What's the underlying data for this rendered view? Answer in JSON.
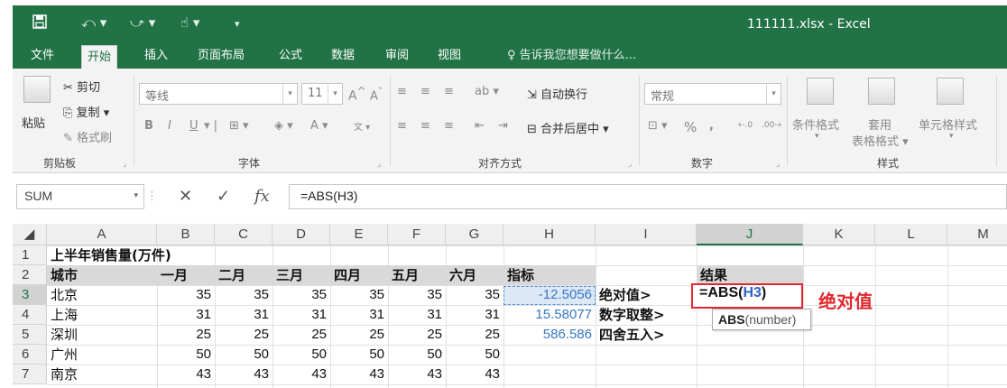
{
  "window": {
    "title": "111111.xlsx  -  Excel"
  },
  "quick_access": {
    "icons": [
      "save-icon",
      "undo-icon",
      "redo-icon",
      "touch-mode-icon",
      "customize-icon"
    ]
  },
  "tabs": [
    {
      "label": "文件"
    },
    {
      "label": "开始"
    },
    {
      "label": "插入"
    },
    {
      "label": "页面布局"
    },
    {
      "label": "公式"
    },
    {
      "label": "数据"
    },
    {
      "label": "审阅"
    },
    {
      "label": "视图"
    }
  ],
  "tell_me": "告诉我您想要做什么...",
  "ribbon": {
    "clipboard": {
      "paste": "粘贴",
      "cut": "剪切",
      "copy": "复制",
      "format_painter": "格式刷",
      "group": "剪贴板"
    },
    "font": {
      "font_name": "等线",
      "font_size": "11",
      "bold": "B",
      "italic": "I",
      "underline": "U",
      "grow": "A",
      "shrink": "A",
      "group": "字体"
    },
    "alignment": {
      "wrap": "自动换行",
      "merge": "合并后居中",
      "group": "对齐方式"
    },
    "number": {
      "format": "常规",
      "percent": "%",
      "comma": ",",
      "group": "数字"
    },
    "styles": {
      "conditional": "条件格式",
      "table_line1": "套用",
      "table_line2": "表格格式",
      "cell_styles": "单元格样式",
      "group": "样式"
    }
  },
  "formula_bar": {
    "name_box": "SUM",
    "cancel": "✕",
    "enter": "✓",
    "fx": "fx",
    "formula": "=ABS(H3)"
  },
  "columns": [
    "A",
    "B",
    "C",
    "D",
    "E",
    "F",
    "G",
    "H",
    "I",
    "J",
    "K",
    "L",
    "M"
  ],
  "rows": [
    "1",
    "2",
    "3",
    "4",
    "5",
    "6",
    "7"
  ],
  "sheet": {
    "title": "上半年销售量(万件)",
    "headers": [
      "城市",
      "一月",
      "二月",
      "三月",
      "四月",
      "五月",
      "六月"
    ],
    "data": [
      {
        "city": "北京",
        "values": [
          "35",
          "35",
          "35",
          "35",
          "35",
          "35"
        ]
      },
      {
        "city": "上海",
        "values": [
          "31",
          "31",
          "31",
          "31",
          "31",
          "31"
        ]
      },
      {
        "city": "深圳",
        "values": [
          "25",
          "25",
          "25",
          "25",
          "25",
          "25"
        ]
      },
      {
        "city": "广州",
        "values": [
          "50",
          "50",
          "50",
          "50",
          "50",
          "50"
        ]
      },
      {
        "city": "南京",
        "values": [
          "43",
          "43",
          "43",
          "43",
          "43",
          "43"
        ]
      }
    ],
    "indicator_header": "指标",
    "indicators": [
      "-12.5056",
      "15.58077",
      "586.586"
    ],
    "labels": [
      "绝对值>",
      "数字取整>",
      "四舍五入>"
    ],
    "result_header": "结果",
    "editing": {
      "prefix": "=ABS(",
      "ref": "H3",
      "suffix": ")"
    },
    "tooltip": {
      "fn": "ABS",
      "args": "(number)"
    },
    "annotation": "绝对值"
  },
  "colors": {
    "excel_green": "#217346",
    "annotation_red": "#e0282e",
    "ref_blue": "#2f62c4"
  }
}
